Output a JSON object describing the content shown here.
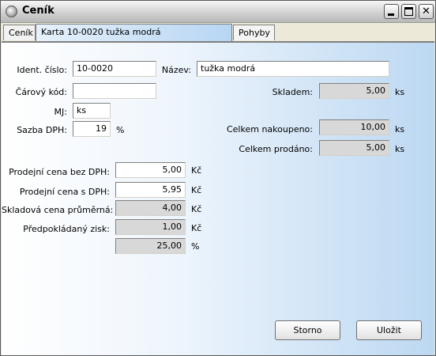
{
  "window": {
    "title": "Ceník"
  },
  "tabs": {
    "cenik": "Ceník",
    "karta": "Karta 10-0020 tužka modrá",
    "pohyby": "Pohyby"
  },
  "form": {
    "ident_label": "Ident. číslo:",
    "ident_value": "10-0020",
    "nazev_label": "Název:",
    "nazev_value": "tužka modrá",
    "carovy_label": "Čárový kód:",
    "carovy_value": "",
    "mj_label": "MJ:",
    "mj_value": "ks",
    "sazba_label": "Sazba DPH:",
    "sazba_value": "19",
    "sazba_unit": "%",
    "skladem_label": "Skladem:",
    "skladem_value": "5,00",
    "skladem_unit": "ks",
    "nakoupeno_label": "Celkem nakoupeno:",
    "nakoupeno_value": "10,00",
    "nakoupeno_unit": "ks",
    "prodano_label": "Celkem prodáno:",
    "prodano_value": "5,00",
    "prodano_unit": "ks",
    "cena_bez_label": "Prodejní cena bez DPH:",
    "cena_bez_value": "5,00",
    "cena_bez_unit": "Kč",
    "cena_s_label": "Prodejní cena s DPH:",
    "cena_s_value": "5,95",
    "cena_s_unit": "Kč",
    "skladova_label": "Skladová cena průměrná:",
    "skladova_value": "4,00",
    "skladova_unit": "Kč",
    "zisk_label": "Předpokládaný zisk:",
    "zisk_value": "1,00",
    "zisk_unit": "Kč",
    "zisk_pct_value": "25,00",
    "zisk_pct_unit": "%"
  },
  "buttons": {
    "storno": "Storno",
    "ulozit": "Uložit"
  }
}
